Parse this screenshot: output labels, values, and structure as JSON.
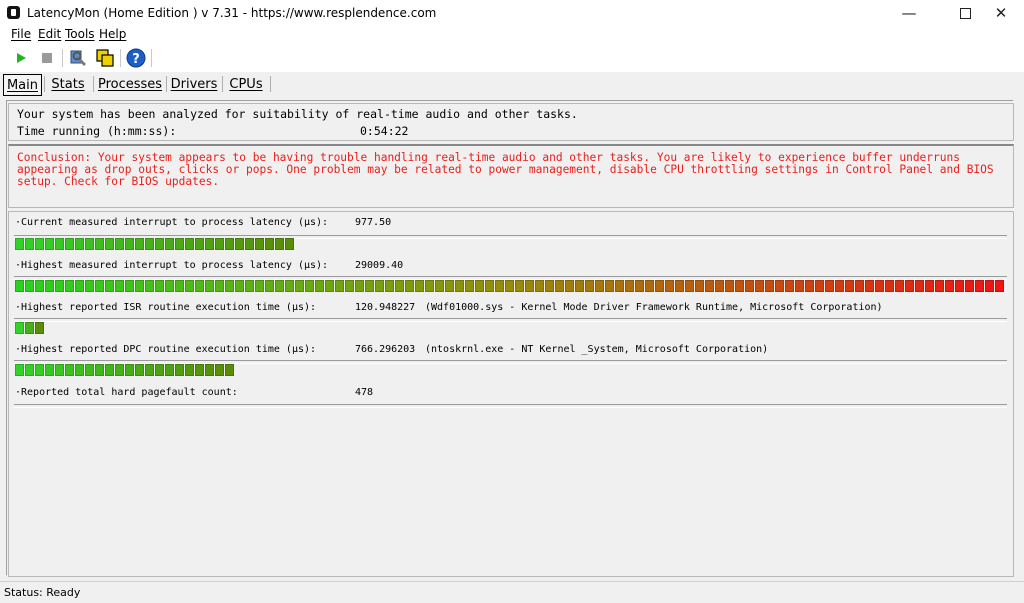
{
  "window": {
    "title": "LatencyMon  (Home Edition )  v 7.31 - https://www.resplendence.com",
    "minimize_icon": "minimize-icon",
    "maximize_icon": "maximize-icon",
    "close_icon": "close-icon"
  },
  "menu": {
    "items": [
      "File",
      "Edit",
      "Tools",
      "Help"
    ]
  },
  "toolbar": {
    "buttons": [
      {
        "icon": "play-icon",
        "color": "#22b422"
      },
      {
        "icon": "stop-icon",
        "color": "#9a9a9a"
      },
      {
        "icon": "wrench-icon",
        "color": "#3a6fb0"
      },
      {
        "icon": "windows-icon",
        "color": "#e0c000"
      },
      {
        "icon": "help-icon",
        "color": "#1e5ec8"
      }
    ]
  },
  "tabs": [
    "Main",
    "Stats",
    "Processes",
    "Drivers",
    "CPUs"
  ],
  "summary": {
    "line1": "Your system has been analyzed for suitability of real-time audio and other tasks.",
    "time_label": "Time running (h:mm:ss):",
    "time_value": "0:54:22"
  },
  "conclusion": {
    "text": "Conclusion: Your system appears to be having trouble handling real-time audio and other tasks. You are likely to experience buffer underruns appearing as drop outs, clicks or pops. One problem may be related to power management, disable CPU throttling settings in Control Panel and BIOS setup. Check for BIOS updates.",
    "color": "#e8201c"
  },
  "metrics": [
    {
      "label": "·Current measured interrupt to process latency (µs):",
      "value": "977.50",
      "desc": "",
      "meter_segments": 28
    },
    {
      "label": "·Highest measured interrupt to process latency (µs):",
      "value": "29009.40",
      "desc": "",
      "meter_segments": 99
    },
    {
      "label": "·Highest reported ISR routine execution time (µs):",
      "value": "120.948227",
      "desc": "(Wdf01000.sys - Kernel Mode Driver Framework Runtime, Microsoft Corporation)",
      "meter_segments": 3
    },
    {
      "label": "·Highest reported DPC routine execution time (µs):",
      "value": "766.296203",
      "desc": "(ntoskrnl.exe - NT Kernel _System, Microsoft Corporation)",
      "meter_segments": 22
    },
    {
      "label": "·Reported total hard pagefault count:",
      "value": "478",
      "desc": "",
      "meter_segments": 0
    }
  ],
  "status": {
    "text": "Status: Ready"
  }
}
